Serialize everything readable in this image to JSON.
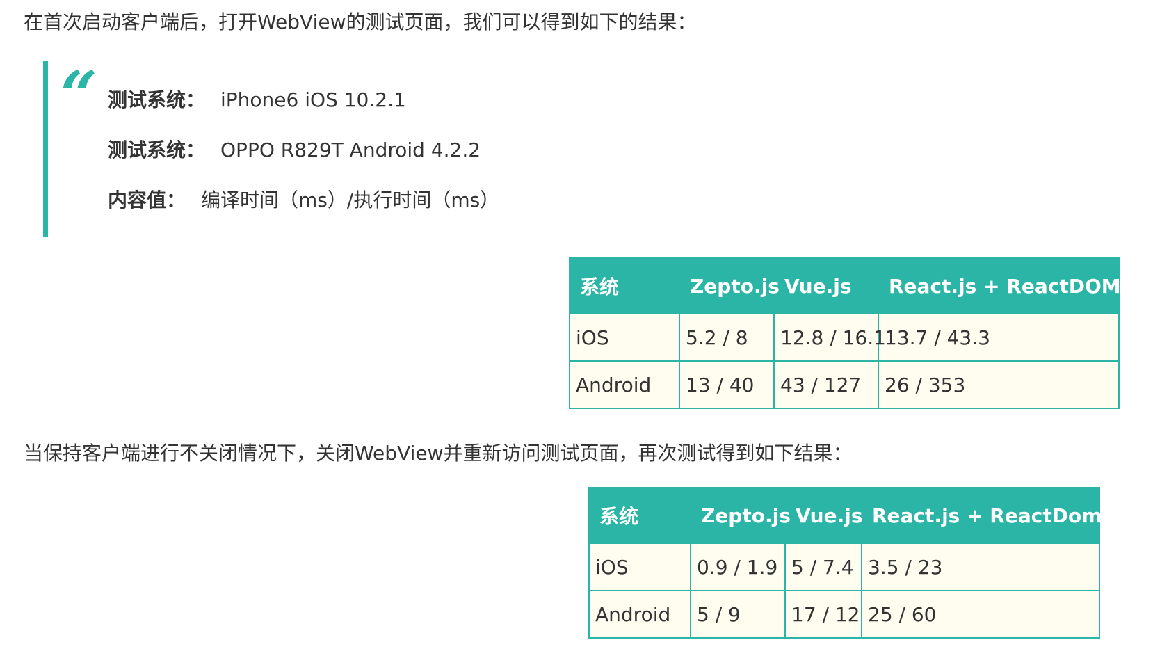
{
  "paragraphs": {
    "intro": "在首次启动客户端后，打开WebView的测试页面，我们可以得到如下的结果：",
    "second": "当保持客户端进行不关闭情况下，关闭WebView并重新访问测试页面，再次测试得到如下结果："
  },
  "quote": {
    "mark": "“",
    "lines": [
      {
        "key": "测试系统：",
        "value": "iPhone6 iOS 10.2.1"
      },
      {
        "key": "测试系统：",
        "value": "OPPO R829T Android 4.2.2"
      },
      {
        "key": "内容值：",
        "value": "编译时间（ms）/执行时间（ms）"
      }
    ]
  },
  "colors": {
    "accent": "#2bb5a6",
    "cell_bg": "#fefdf0",
    "text": "#333333"
  },
  "table1": {
    "headers": [
      "系统",
      "Zepto.js",
      "Vue.js",
      "React.js + ReactDOM.js"
    ],
    "rows": [
      [
        "iOS",
        "5.2 / 8",
        "12.8 / 16.1",
        "13.7 / 43.3"
      ],
      [
        "Android",
        "13 / 40",
        "43 / 127",
        "26 / 353"
      ]
    ]
  },
  "table2": {
    "headers": [
      "系统",
      "Zepto.js",
      "Vue.js",
      "React.js + ReactDom.js"
    ],
    "rows": [
      [
        "iOS",
        "0.9 / 1.9",
        "5 / 7.4",
        "3.5 / 23"
      ],
      [
        "Android",
        "5 / 9",
        "17 / 12",
        "25 / 60"
      ]
    ]
  }
}
